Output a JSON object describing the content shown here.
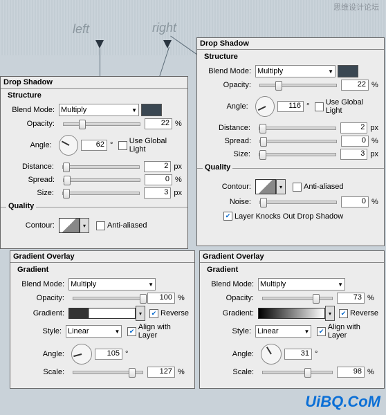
{
  "labels": {
    "left": "left",
    "right": "right"
  },
  "watermark": "UiBQ.CoM",
  "wm2": "思维设计论坛",
  "ds": {
    "header": "Drop Shadow",
    "structure": "Structure",
    "quality": "Quality",
    "blend": "Blend Mode:",
    "opacity": "Opacity:",
    "angle": "Angle:",
    "distance": "Distance:",
    "spread": "Spread:",
    "size": "Size:",
    "contour": "Contour:",
    "noise": "Noise:",
    "ugl": "Use Global Light",
    "aa": "Anti-aliased",
    "knocks": "Layer Knocks Out Drop Shadow",
    "deg": "°",
    "pct": "%",
    "px": "px"
  },
  "go": {
    "header": "Gradient Overlay",
    "gradient": "Gradient",
    "blend": "Blend Mode:",
    "opacity": "Opacity:",
    "gradient_l": "Gradient:",
    "style": "Style:",
    "angle": "Angle:",
    "scale": "Scale:",
    "reverse": "Reverse",
    "align": "Align with Layer",
    "pct": "%",
    "deg": "°"
  },
  "left": {
    "ds": {
      "mode": "Multiply",
      "opacity": "22",
      "angle": "62",
      "distance": "2",
      "spread": "0",
      "size": "3",
      "ugl": false,
      "aa": false
    },
    "go": {
      "mode": "Multiply",
      "opacity": "100",
      "style": "Linear",
      "angle": "105",
      "scale": "127",
      "reverse": true,
      "align": true
    }
  },
  "right": {
    "ds": {
      "mode": "Multiply",
      "opacity": "22",
      "angle": "116",
      "distance": "2",
      "spread": "0",
      "size": "3",
      "ugl": false,
      "aa": false,
      "noise": "0",
      "knocks": true
    },
    "go": {
      "mode": "Multiply",
      "opacity": "73",
      "style": "Linear",
      "angle": "31",
      "scale": "98",
      "reverse": true,
      "align": true
    }
  }
}
